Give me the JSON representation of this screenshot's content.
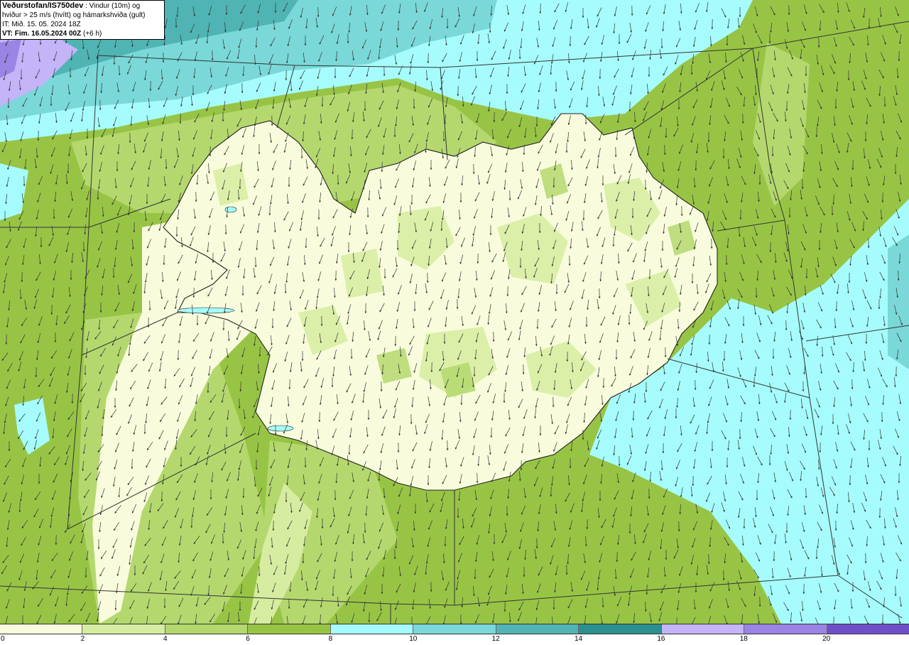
{
  "header": {
    "title_bold": "Veðurstofan/IS750dev",
    "title_rest": " : Vindur (10m) og",
    "line2": "hviður > 25 m/s (hvítt) og hámarkshviða (gult)",
    "line3": "IT: Mið. 15. 05. 2024 18Z",
    "vt_bold": "VT: Fim. 16.05.2024 00Z",
    "vt_rest": " (+6 h)"
  },
  "legend": {
    "ticks": [
      "0",
      "2",
      "4",
      "6",
      "8",
      "10",
      "12",
      "14",
      "16",
      "18",
      "20"
    ],
    "colors": [
      "#f8fcdc",
      "#d6eca0",
      "#b4d86e",
      "#98c446",
      "#a6fcfc",
      "#7ad8d8",
      "#50b4b4",
      "#2a9090",
      "#c4b4f8",
      "#9a84e4",
      "#7050c8"
    ]
  },
  "map": {
    "land_color": "#f4f9dc",
    "coast_color": "#222222"
  }
}
